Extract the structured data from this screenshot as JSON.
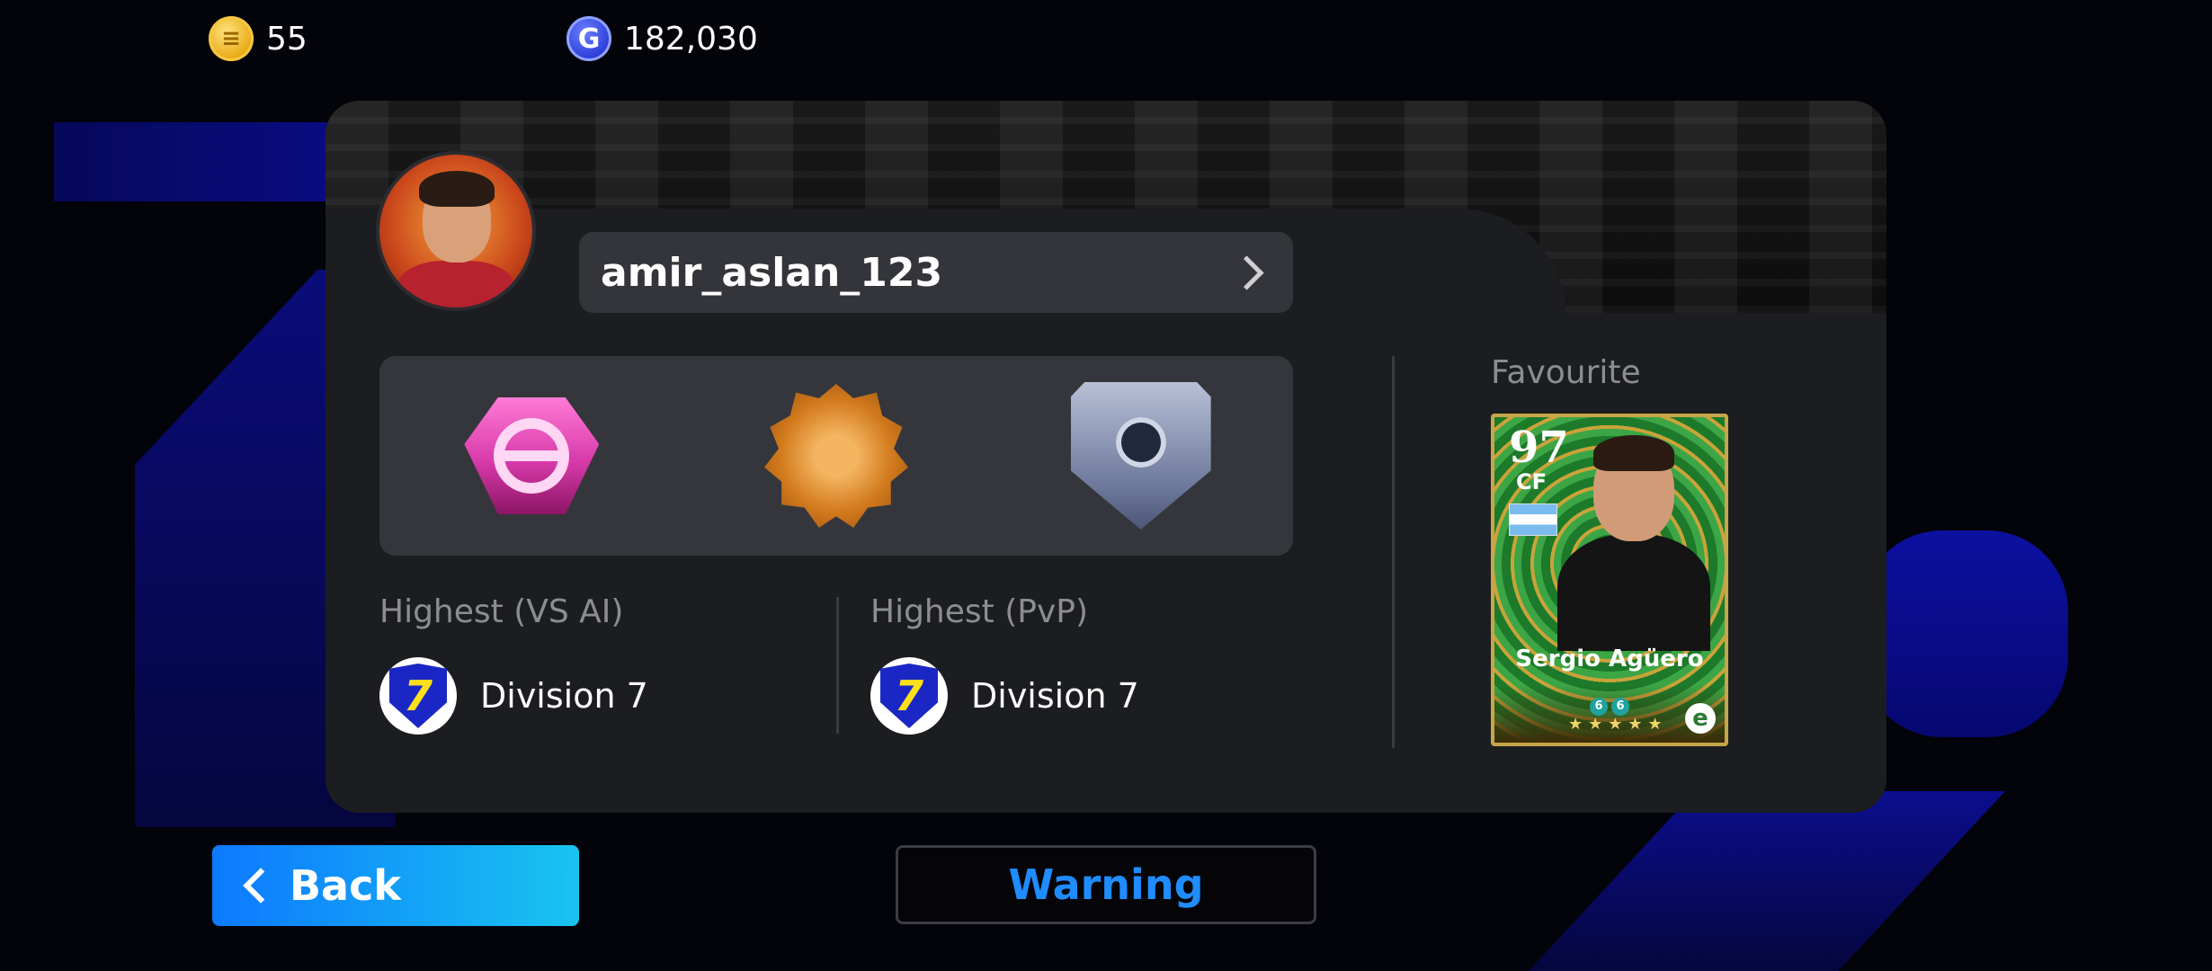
{
  "currency": {
    "coins": {
      "icon": "efootball-coin-icon",
      "value": "55"
    },
    "gp": {
      "icon": "gp-icon",
      "glyph": "G",
      "value": "182,030"
    }
  },
  "profile": {
    "username": "amir_aslan_123",
    "avatar": "player-avatar"
  },
  "badges": [
    {
      "name": "efootball-badge-icon"
    },
    {
      "name": "gear-ball-badge-icon"
    },
    {
      "name": "shield-ball-badge-icon"
    }
  ],
  "records": {
    "vs_ai": {
      "label": "Highest (VS AI)",
      "division_number": "7",
      "division": "Division 7"
    },
    "pvp": {
      "label": "Highest (PvP)",
      "division_number": "7",
      "division": "Division 7"
    }
  },
  "favourite": {
    "label": "Favourite",
    "card": {
      "rating": "97",
      "position": "CF",
      "player_name": "Sergio Agüero",
      "nation_flag": "argentina-flag-icon"
    }
  },
  "buttons": {
    "back": "Back",
    "warning": "Warning"
  },
  "colors": {
    "accent_blue": "#1f8cff",
    "back_gradient_start": "#0d79ff",
    "back_gradient_end": "#19c4f0",
    "panel_bg": "#1c1d21",
    "division_yellow": "#ffe11a"
  }
}
